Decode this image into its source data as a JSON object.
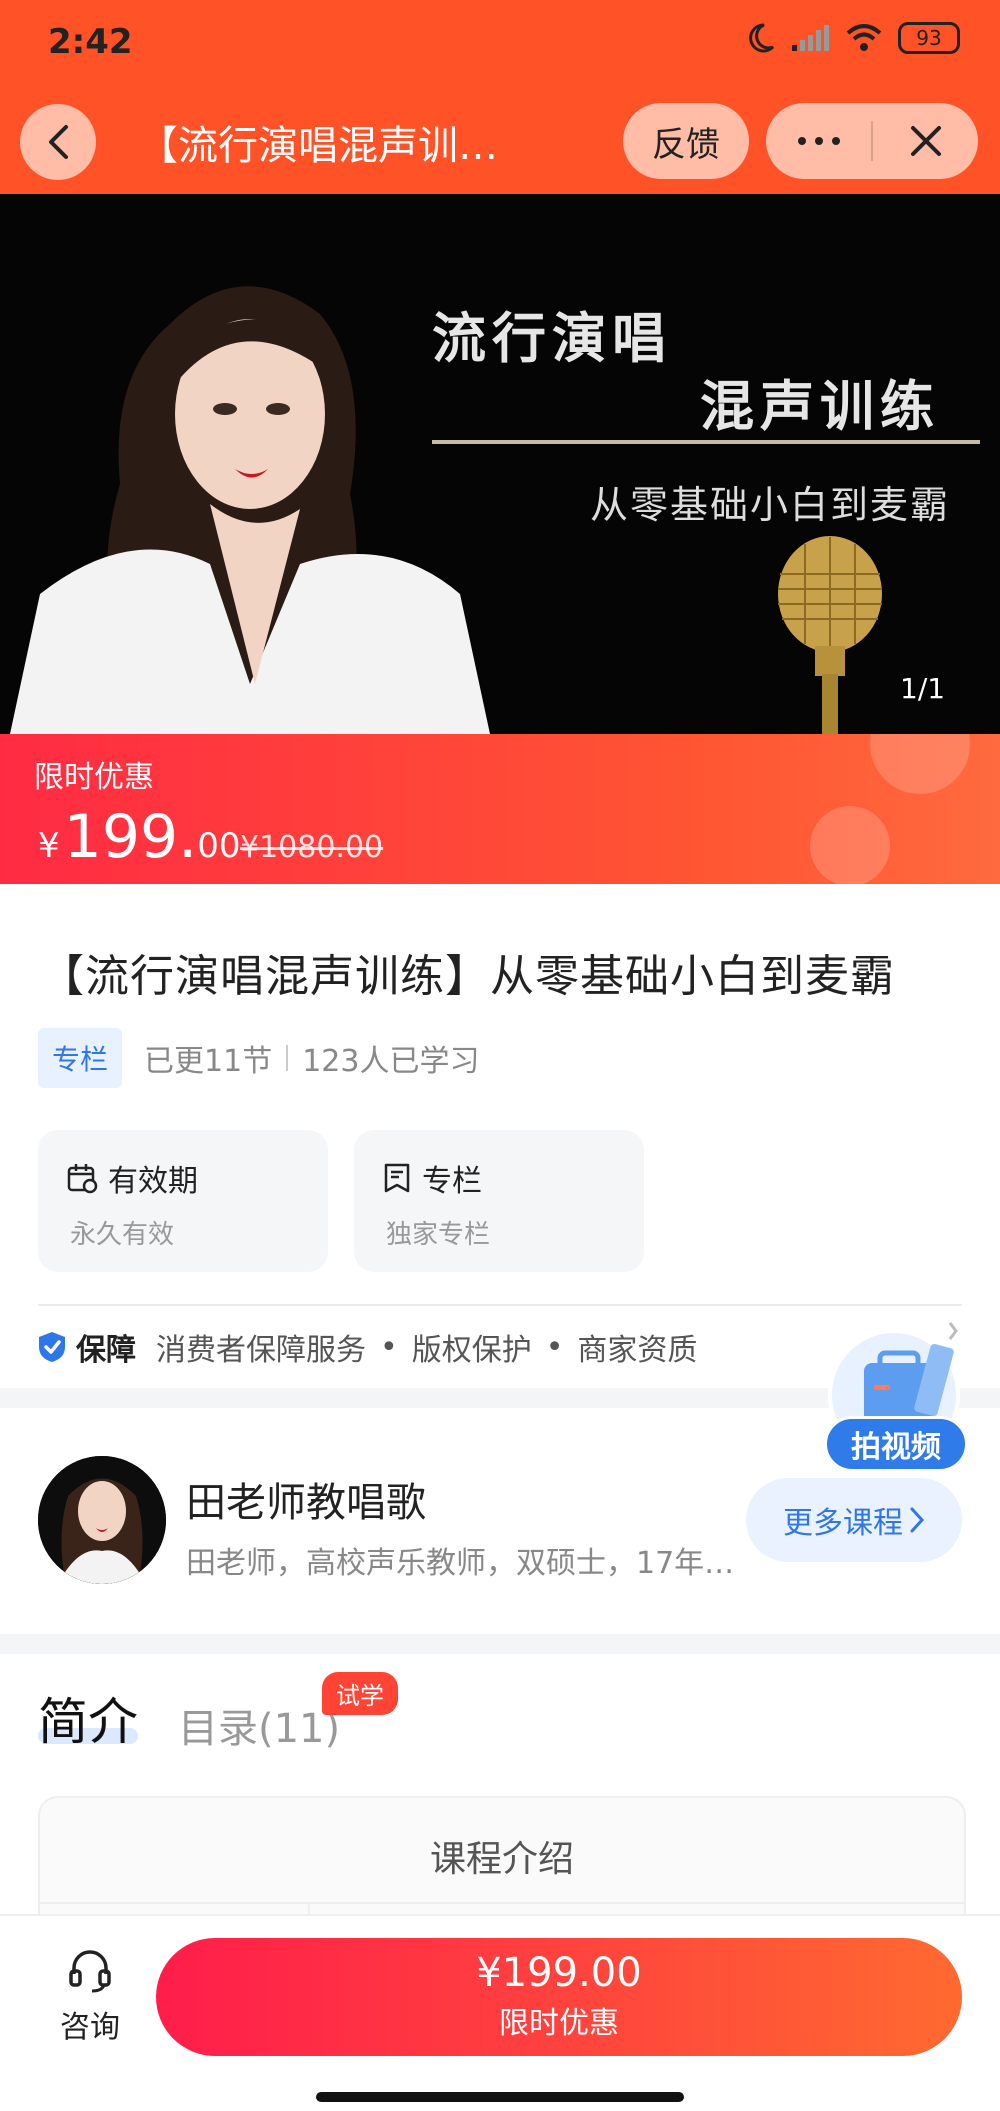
{
  "status_bar": {
    "time": "2:42",
    "battery": "93"
  },
  "nav": {
    "title": "【流行演唱混声训…",
    "feedback_label": "反馈"
  },
  "banner": {
    "title_line1": "流行演唱",
    "title_line2": "混声训练",
    "subtitle": "从零基础小白到麦霸",
    "counter": "1/1"
  },
  "price": {
    "promo_label": "限时优惠",
    "currency": "¥",
    "integer": "199.",
    "decimal": "00",
    "original": "¥1080.00"
  },
  "course": {
    "title": "【流行演唱混声训练】从零基础小白到麦霸",
    "tag": "专栏",
    "updated": "已更11节",
    "learners": "123人已学习"
  },
  "info_cards": [
    {
      "title": "有效期",
      "sub": "永久有效",
      "icon": "calendar-icon"
    },
    {
      "title": "专栏",
      "sub": "独家专栏",
      "icon": "bookmark-icon"
    }
  ],
  "guarantee": {
    "title": "保障",
    "items": [
      "消费者保障服务",
      "版权保护",
      "商家资质"
    ]
  },
  "float_button": {
    "label": "拍视频"
  },
  "teacher": {
    "name": "田老师教唱歌",
    "desc": "田老师，高校声乐教师，双硕士，17年…",
    "more_label": "更多课程"
  },
  "tabs": {
    "active": "简介",
    "inactive": "目录(11)",
    "badge": "试学"
  },
  "intro": {
    "label": "课程介绍"
  },
  "bottom": {
    "consult_label": "咨询",
    "buy_price": "¥199.00",
    "buy_promo": "限时优惠"
  },
  "colors": {
    "header": "#ff5227",
    "accent_blue": "#2f77e8",
    "buy_gradient_start": "#ff1d4b",
    "buy_gradient_end": "#ff6a30"
  }
}
